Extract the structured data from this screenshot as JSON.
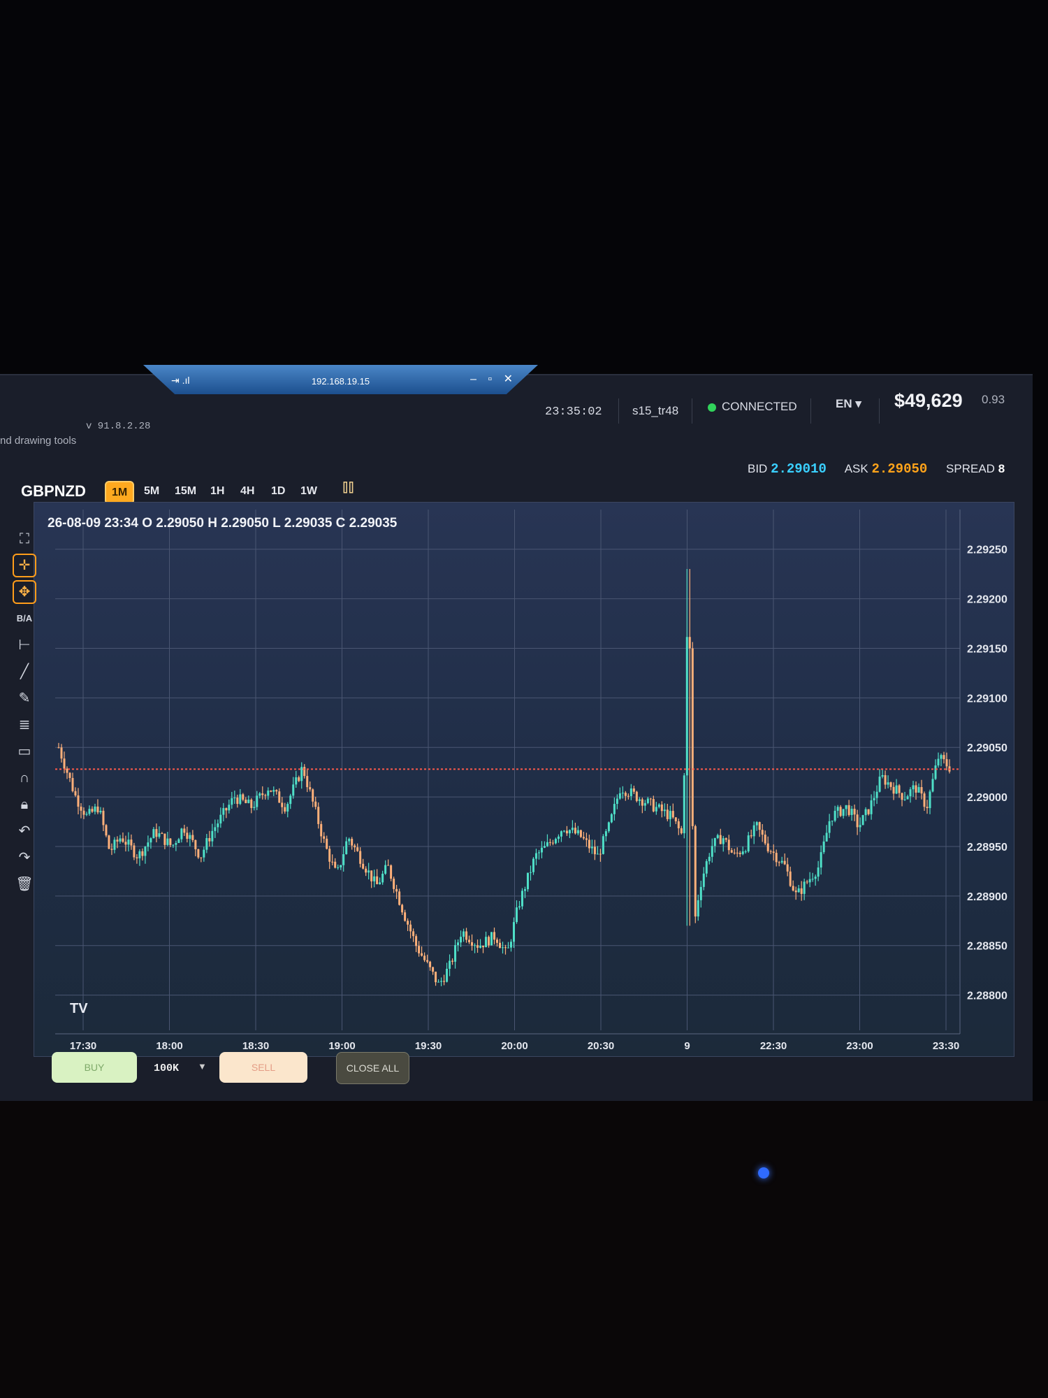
{
  "remote_session": {
    "host": "192.168.19.15",
    "left_icons": "⇥ .ıl",
    "window_controls": "– ▫ ✕"
  },
  "header": {
    "version": "v 91.8.2.28",
    "tools_hint": "nd drawing tools",
    "clock": "23:35:02",
    "account": "s15_tr48",
    "status": "CONNECTED",
    "language": "EN ▾",
    "balance": "$49,629",
    "ratio": "0.93"
  },
  "symbol": "GBPNZD",
  "timeframes": [
    {
      "label": "1M",
      "active": true
    },
    {
      "label": "5M",
      "active": false
    },
    {
      "label": "15M",
      "active": false
    },
    {
      "label": "1H",
      "active": false
    },
    {
      "label": "4H",
      "active": false
    },
    {
      "label": "1D",
      "active": false
    },
    {
      "label": "1W",
      "active": false
    }
  ],
  "quote": {
    "bid_label": "BID",
    "bid": "2.29010",
    "ask_label": "ASK",
    "ask": "2.29050",
    "spread_label": "SPREAD",
    "spread": "8"
  },
  "ohlc_line": "26-08-09 23:34 O 2.29050 H 2.29050 L 2.29035 C 2.29035",
  "tools": [
    "fullscreen-icon",
    "crosshair-icon",
    "move-icon",
    "bid-ask-icon",
    "horizontal-line-icon",
    "trendline-icon",
    "pencil-icon",
    "fib-icon",
    "rectangle-icon",
    "magnet-icon",
    "lock-icon",
    "undo-icon",
    "redo-icon",
    "trash-icon"
  ],
  "tool_labels": {
    "bid_ask": "B/A"
  },
  "footer": {
    "buy": "BUY",
    "quantity": "100K",
    "sell": "SELL",
    "close_all": "CLOSE ALL"
  },
  "tradingview_mark": "TV",
  "colors": {
    "up": "#4fe0c8",
    "down": "#ffb07a",
    "price_line": "#ff5a4a",
    "accent": "#ffa91f"
  },
  "chart_data": {
    "type": "candlestick",
    "ylim": [
      2.28775,
      2.2929
    ],
    "y_ticks": [
      "2.29250",
      "2.29200",
      "2.29150",
      "2.29100",
      "2.29050",
      "2.29000",
      "2.28950",
      "2.28900",
      "2.28850",
      "2.28800"
    ],
    "x_tick_labels": [
      "17:30",
      "18:00",
      "18:30",
      "19:00",
      "19:30",
      "20:00",
      "20:30",
      "9",
      "22:30",
      "23:00",
      "23:30"
    ],
    "current_price_line": 2.29028,
    "path": [
      [
        0,
        2.2905
      ],
      [
        3,
        2.29
      ],
      [
        5,
        2.2898
      ],
      [
        7,
        2.2899
      ],
      [
        9,
        2.28945
      ],
      [
        11,
        2.2896
      ],
      [
        14,
        2.2894
      ],
      [
        17,
        2.28965
      ],
      [
        20,
        2.2895
      ],
      [
        22,
        2.2897
      ],
      [
        25,
        2.2894
      ],
      [
        27,
        2.28965
      ],
      [
        31,
        2.29
      ],
      [
        34,
        2.2899
      ],
      [
        37,
        2.2901
      ],
      [
        40,
        2.2899
      ],
      [
        43,
        2.2903
      ],
      [
        45,
        2.2899
      ],
      [
        47,
        2.2895
      ],
      [
        49,
        2.2892
      ],
      [
        51,
        2.2896
      ],
      [
        53,
        2.2894
      ],
      [
        56,
        2.2891
      ],
      [
        58,
        2.2893
      ],
      [
        61,
        2.2888
      ],
      [
        63,
        2.2885
      ],
      [
        65,
        2.2883
      ],
      [
        67,
        2.2881
      ],
      [
        69,
        2.2883
      ],
      [
        71,
        2.28865
      ],
      [
        74,
        2.2885
      ],
      [
        77,
        2.2886
      ],
      [
        79,
        2.2884
      ],
      [
        81,
        2.2889
      ],
      [
        84,
        2.2894
      ],
      [
        86,
        2.2895
      ],
      [
        89,
        2.2897
      ],
      [
        92,
        2.2896
      ],
      [
        95,
        2.2894
      ],
      [
        97,
        2.2897
      ],
      [
        99,
        2.2901
      ],
      [
        102,
        2.29
      ],
      [
        105,
        2.2899
      ],
      [
        108,
        2.2898
      ],
      [
        110,
        2.2896
      ],
      [
        111,
        2.2923
      ],
      [
        112,
        2.2887
      ],
      [
        113,
        2.2891
      ],
      [
        115,
        2.2895
      ],
      [
        117,
        2.2896
      ],
      [
        119,
        2.2894
      ],
      [
        121,
        2.2895
      ],
      [
        123,
        2.2897
      ],
      [
        125,
        2.2895
      ],
      [
        128,
        2.2893
      ],
      [
        130,
        2.289
      ],
      [
        132,
        2.28915
      ],
      [
        134,
        2.2893
      ],
      [
        136,
        2.2898
      ],
      [
        139,
        2.2899
      ],
      [
        141,
        2.2897
      ],
      [
        143,
        2.2899
      ],
      [
        145,
        2.2902
      ],
      [
        147,
        2.2901
      ],
      [
        149,
        2.29
      ],
      [
        151,
        2.2901
      ],
      [
        153,
        2.2899
      ],
      [
        155,
        2.2904
      ],
      [
        157,
        2.2903
      ]
    ]
  }
}
